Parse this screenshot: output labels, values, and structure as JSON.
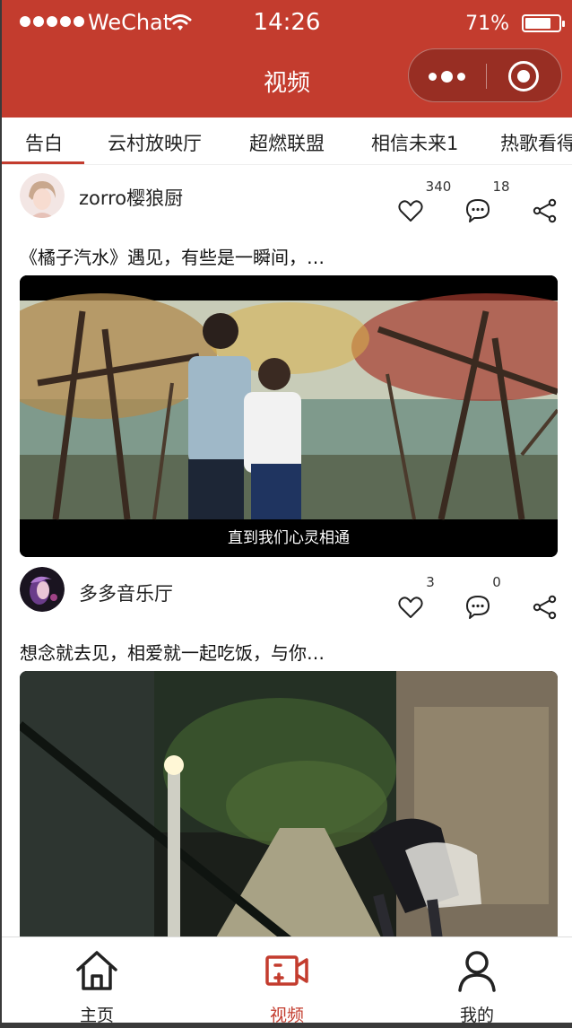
{
  "status_bar": {
    "carrier": "WeChat",
    "time": "14:26",
    "battery": "71%"
  },
  "nav": {
    "title": "视频"
  },
  "tabs": [
    {
      "label": "告白",
      "active": true
    },
    {
      "label": "云村放映厅"
    },
    {
      "label": "超燃联盟"
    },
    {
      "label": "相信未来1"
    },
    {
      "label": "热歌看得"
    }
  ],
  "posts": [
    {
      "author": "zorro樱狼厨",
      "likes": "340",
      "comments": "18",
      "description": "《橘子汽水》遇见，有些是一瞬间，…",
      "subtitle": "直到我们心灵相通"
    },
    {
      "author": "多多音乐厅",
      "likes": "3",
      "comments": "0",
      "description": "想念就去见，相爱就一起吃饭，与你…"
    }
  ],
  "tabbar": [
    {
      "label": "主页",
      "icon": "home-icon"
    },
    {
      "label": "视频",
      "icon": "video-icon",
      "active": true
    },
    {
      "label": "我的",
      "icon": "user-icon"
    }
  ],
  "colors": {
    "accent": "#c33c2e",
    "text": "#222222",
    "background": "#ffffff"
  }
}
